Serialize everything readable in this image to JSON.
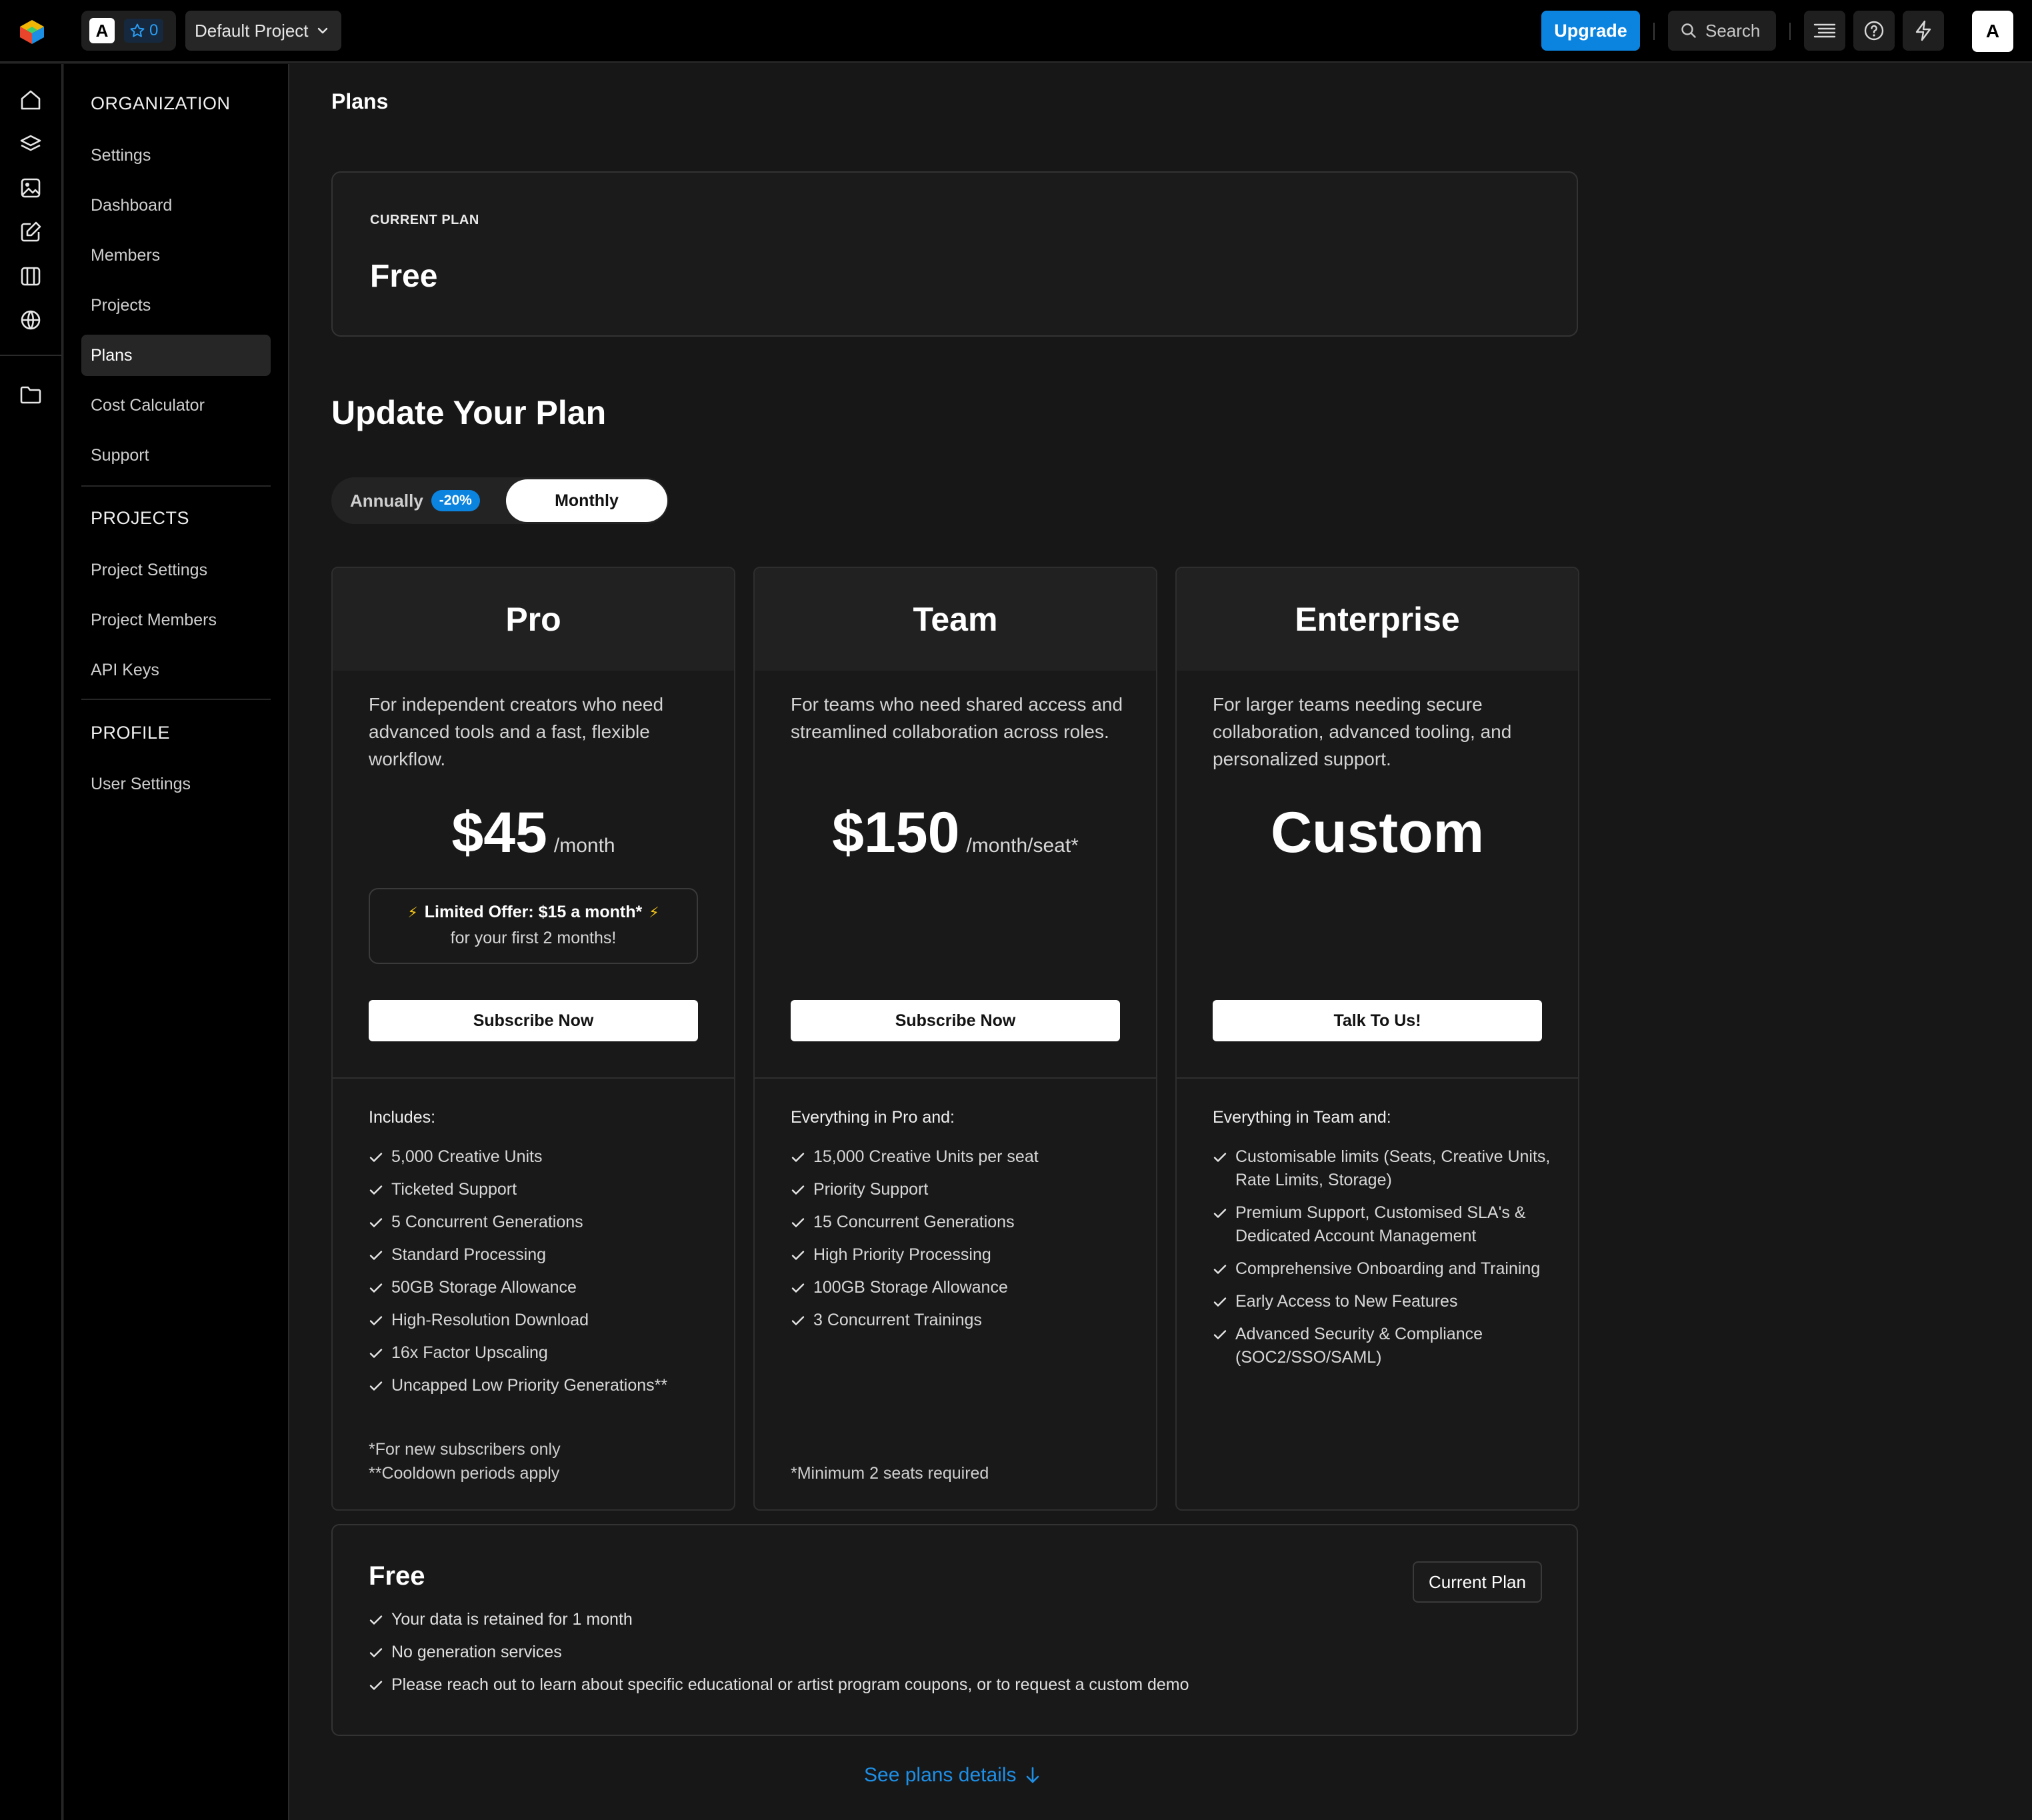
{
  "topbar": {
    "org_initial": "A",
    "star_count": "0",
    "project_name": "Default Project",
    "upgrade_label": "Upgrade",
    "search_label": "Search",
    "user_initial": "A"
  },
  "sidebar": {
    "organization_heading": "ORGANIZATION",
    "organization_items": [
      "Settings",
      "Dashboard",
      "Members",
      "Projects",
      "Plans",
      "Cost Calculator",
      "Support"
    ],
    "projects_heading": "PROJECTS",
    "projects_items": [
      "Project Settings",
      "Project Members",
      "API Keys"
    ],
    "profile_heading": "PROFILE",
    "profile_items": [
      "User Settings"
    ]
  },
  "main": {
    "page_title": "Plans",
    "current_plan_label": "CURRENT PLAN",
    "current_plan_name": "Free",
    "update_title": "Update Your Plan",
    "billing": {
      "annually_label": "Annually",
      "discount": "-20%",
      "monthly_label": "Monthly",
      "selected": "Monthly"
    },
    "plans": [
      {
        "name": "Pro",
        "description": "For independent creators who need advanced tools and a fast, flexible workflow.",
        "price": "$45",
        "unit": "/month",
        "offer_line1": "Limited Offer: $15 a month*",
        "offer_line2": "for your first 2 months!",
        "button": "Subscribe Now",
        "includes_title": "Includes:",
        "features": [
          "5,000 Creative Units",
          "Ticketed Support",
          "5 Concurrent Generations",
          "Standard Processing",
          "50GB Storage Allowance",
          "High-Resolution Download",
          "16x Factor Upscaling",
          "Uncapped Low Priority Generations**"
        ],
        "footnote1": "*For new subscribers only",
        "footnote2": "**Cooldown periods apply"
      },
      {
        "name": "Team",
        "description": "For teams who need shared access and streamlined collaboration across roles.",
        "price": "$150",
        "unit": "/month/seat*",
        "button": "Subscribe Now",
        "includes_title": "Everything in Pro and:",
        "features": [
          "15,000 Creative Units per seat",
          "Priority Support",
          "15 Concurrent Generations",
          "High Priority Processing",
          "100GB Storage Allowance",
          "3 Concurrent Trainings"
        ],
        "footnote1": "*Minimum 2 seats required"
      },
      {
        "name": "Enterprise",
        "description": "For larger teams needing secure collaboration, advanced tooling, and personalized support.",
        "price": "Custom",
        "button": "Talk To Us!",
        "includes_title": "Everything in Team and:",
        "features": [
          "Customisable limits (Seats, Creative Units, Rate Limits, Storage)",
          "Premium Support, Customised SLA's & Dedicated Account Management",
          "Comprehensive Onboarding and Training",
          "Early Access to New Features",
          "Advanced Security & Compliance (SOC2/SSO/SAML)"
        ]
      }
    ],
    "free_plan": {
      "title": "Free",
      "button": "Current Plan",
      "features": [
        "Your data is retained for 1 month",
        "No generation services",
        "Please reach out to learn about specific educational or artist program coupons, or to request a custom demo"
      ]
    },
    "see_details": "See plans details"
  },
  "colors": {
    "accent": "#0b84e0",
    "background": "#171717",
    "panel": "#000000",
    "card": "#191919",
    "bolt": "#f5c518"
  }
}
